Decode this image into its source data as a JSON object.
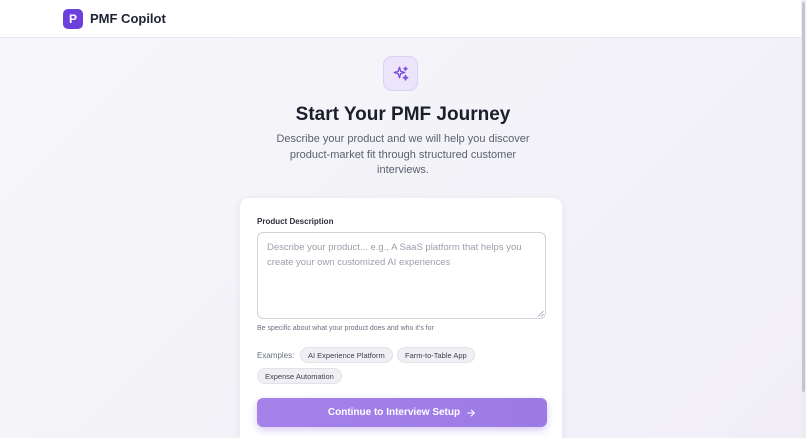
{
  "header": {
    "logo_letter": "P",
    "brand_name": "PMF Copilot"
  },
  "hero": {
    "icon": "sparkles-icon",
    "title": "Start Your PMF Journey",
    "subtitle": "Describe your product and we will help you discover product-market fit through structured customer interviews."
  },
  "form": {
    "label": "Product Description",
    "value": "",
    "placeholder": "Describe your product... e.g., A SaaS platform that helps you create your own customized AI experiences",
    "hint": "Be specific about what your product does and who it's for",
    "examples_label": "Examples:",
    "examples": [
      "AI Experience Platform",
      "Farm-to-Table App",
      "Expense Automation"
    ],
    "submit_label": "Continue to Interview Setup",
    "submit_icon": "arrow-right-icon"
  },
  "colors": {
    "brand": "#6d3fdc",
    "accent": "#a582ea"
  }
}
